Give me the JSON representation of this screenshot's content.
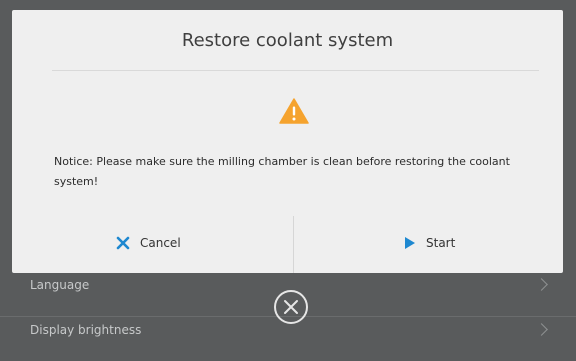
{
  "background": {
    "items": [
      {
        "label": "Language"
      },
      {
        "label": "Display brightness"
      }
    ]
  },
  "dialog": {
    "title": "Restore coolant system",
    "warning_icon": "warning-triangle-icon",
    "notice": "Notice: Please make sure the milling chamber is clean before restoring the coolant system!",
    "cancel_label": "Cancel",
    "start_label": "Start"
  },
  "close_icon": "close-circle-icon",
  "colors": {
    "warning": "#f5a32e",
    "cancel_icon": "#1e88d0",
    "start_icon": "#1e88d0",
    "dialog_bg": "#efefef",
    "overlay_bg": "#595b5c"
  }
}
